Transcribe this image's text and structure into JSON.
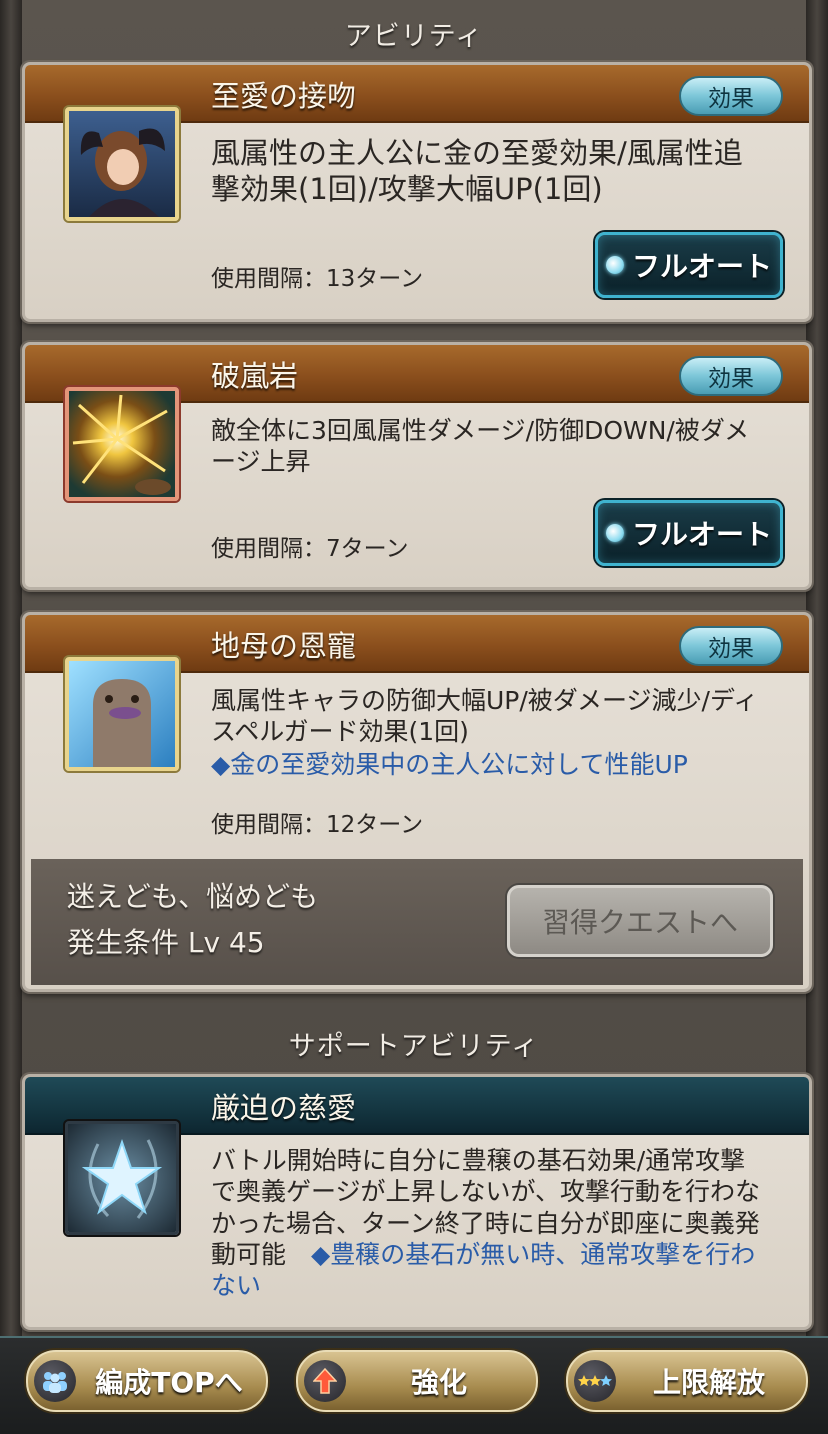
{
  "sections": {
    "ability_title": "アビリティ",
    "support_title": "サポートアビリティ"
  },
  "effect_label": "効果",
  "fullauto_label": "フルオート",
  "abilities": [
    {
      "name": "至愛の接吻",
      "desc": "風属性の主人公に金の至愛効果/風属性追撃効果(1回)/攻撃大幅UP(1回)",
      "interval": "使用間隔：13ターン"
    },
    {
      "name": "破嵐岩",
      "desc": "敵全体に3回風属性ダメージ/防御DOWN/被ダメージ上昇",
      "interval": "使用間隔：7ターン"
    },
    {
      "name": "地母の恩寵",
      "desc": "風属性キャラの防御大幅UP/被ダメージ減少/ディスペルガード効果(1回)",
      "note": "◆金の至愛効果中の主人公に対して性能UP",
      "interval": "使用間隔：12ターン",
      "quest": {
        "name": "迷えども、悩めども",
        "condition": "発生条件 Lv 45",
        "button": "習得クエストへ"
      }
    }
  ],
  "support": {
    "name": "厳迫の慈愛",
    "desc": "バトル開始時に自分に豊穣の基石効果/通常攻撃で奥義ゲージが上昇しないが、攻撃行動を行わなかった場合、ターン終了時に自分が即座に奥義発動可能",
    "note": "◆豊穣の基石が無い時、通常攻撃を行わない"
  },
  "bottom_nav": {
    "party_top": "編成TOPへ",
    "enhance": "強化",
    "limit_break": "上限解放"
  }
}
